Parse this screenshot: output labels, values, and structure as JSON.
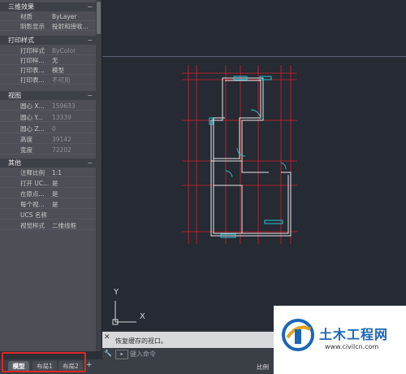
{
  "palette": {
    "sections": [
      {
        "title": "三维效果",
        "rows": [
          {
            "k": "材质",
            "v": "ByLayer"
          },
          {
            "k": "阴影显示",
            "v": "投射和接收..."
          }
        ]
      },
      {
        "title": "打印样式",
        "rows": [
          {
            "k": "打印样式",
            "v": "ByColor",
            "dim": true
          },
          {
            "k": "打印样...",
            "v": "无"
          },
          {
            "k": "打印表...",
            "v": "模型"
          },
          {
            "k": "打印表...",
            "v": "不可用",
            "dim": true
          }
        ]
      },
      {
        "title": "视图",
        "rows": [
          {
            "k": "圆心 X...",
            "v": "159633",
            "dim": true
          },
          {
            "k": "圆心 Y...",
            "v": "13339",
            "dim": true
          },
          {
            "k": "圆心 Z...",
            "v": "0",
            "dim": true
          },
          {
            "k": "高度",
            "v": "39142",
            "dim": true
          },
          {
            "k": "宽度",
            "v": "72202",
            "dim": true
          }
        ]
      },
      {
        "title": "其他",
        "rows": [
          {
            "k": "注释比例",
            "v": "1:1"
          },
          {
            "k": "打开 UC...",
            "v": "是"
          },
          {
            "k": "在原点...",
            "v": "是"
          },
          {
            "k": "每个视...",
            "v": "是"
          },
          {
            "k": "UCS 名称",
            "v": ""
          },
          {
            "k": "视觉样式",
            "v": "二维线框"
          }
        ]
      }
    ],
    "toggle_glyph": "−"
  },
  "ucs": {
    "x_label": "X",
    "y_label": "Y"
  },
  "command": {
    "history": "恢复缓存的视口。",
    "prompt": "键入命令",
    "close": "✕",
    "wrench": "🔧"
  },
  "tabs": {
    "model": "模型",
    "layout1": "布局1",
    "layout2": "布局2",
    "plus": "+"
  },
  "status": {
    "scale": "比例"
  },
  "watermark": {
    "name": "土木工程网",
    "url": "www.civilcn.com"
  },
  "colors": {
    "grid_red": "#d8222a",
    "wall": "#e6e6e6",
    "cyan": "#2bc6d8",
    "highlight": "#e0262a"
  }
}
